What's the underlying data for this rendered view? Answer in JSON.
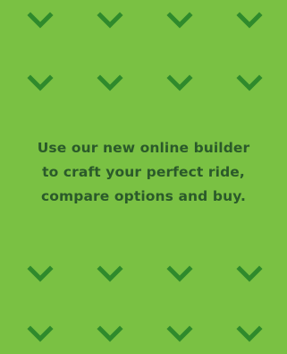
{
  "banner": {
    "background_color": "#7ac143",
    "chevron_color": "#2f8a2c",
    "text_color": "#2b5a2a",
    "chevron_icon": "chevron-down-icon",
    "message_lines": [
      "Use our new online builder",
      "to craft your perfect ride,",
      "compare options and buy."
    ]
  }
}
